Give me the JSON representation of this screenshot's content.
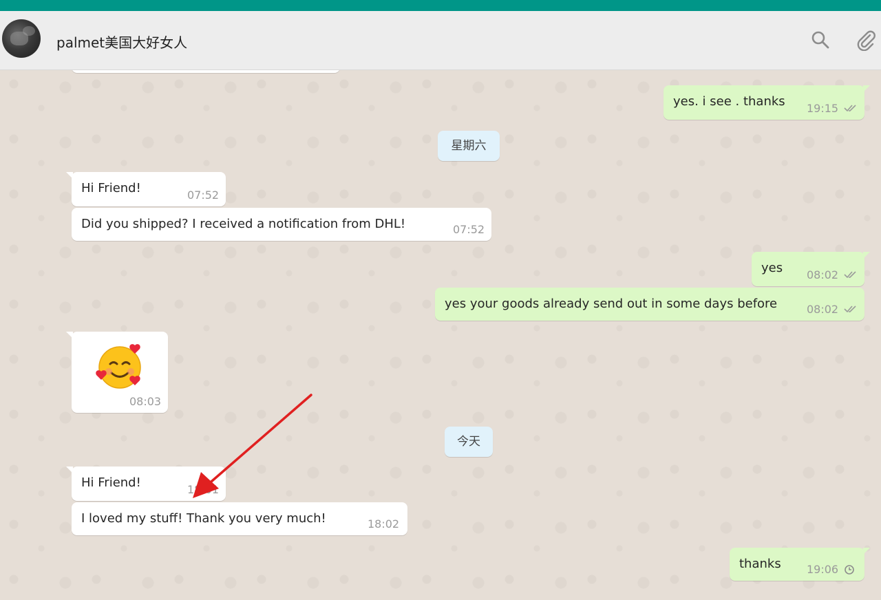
{
  "contact": {
    "name": "palmet美国大好女人"
  },
  "icons": {
    "search": "search-icon",
    "attach": "paperclip-icon",
    "read": "double-check-icon",
    "pending": "clock-icon"
  },
  "colors": {
    "topbar": "#009688",
    "incoming": "#ffffff",
    "outgoing": "#dcf8c6",
    "date_chip": "#e1f2fb"
  },
  "messages": [
    {
      "dir": "out",
      "text": "yes. i see . thanks",
      "time": "19:15",
      "status": "read"
    },
    {
      "dir": "in",
      "text": "Hi Friend!",
      "time": "07:52"
    },
    {
      "dir": "in",
      "text": "Did you shipped? I received a notification from DHL!",
      "time": "07:52"
    },
    {
      "dir": "out",
      "text": "yes",
      "time": "08:02",
      "status": "read"
    },
    {
      "dir": "out",
      "text": "yes  your goods already send out in some days before",
      "time": "08:02",
      "status": "read"
    },
    {
      "dir": "in",
      "text": "",
      "emoji": "smiling-face-with-hearts",
      "time": "08:03"
    },
    {
      "dir": "in",
      "text": "Hi Friend!",
      "time": "18:01"
    },
    {
      "dir": "in",
      "text": "I loved my stuff! Thank you very much!",
      "time": "18:02"
    },
    {
      "dir": "out",
      "text": "thanks",
      "time": "19:06",
      "status": "pending"
    }
  ],
  "date_dividers": [
    "星期六",
    "今天"
  ]
}
